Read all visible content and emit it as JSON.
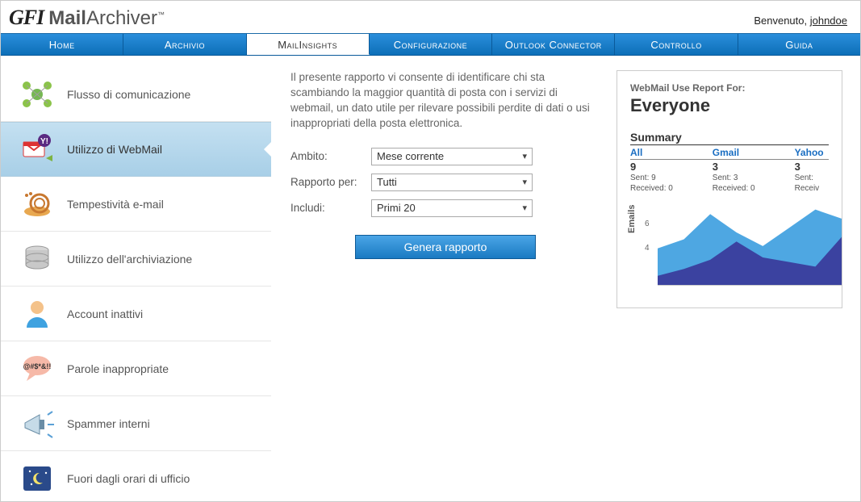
{
  "header": {
    "welcome_prefix": "Benvenuto, ",
    "username": "johndoe"
  },
  "nav": {
    "home": "Home",
    "archive": "Archivio",
    "mailinsights": "MailInsights",
    "config": "Configurazione",
    "outlook": "Outlook Connector",
    "control": "Controllo",
    "guide": "Guida"
  },
  "sidebar": {
    "flow": "Flusso di comunicazione",
    "webmail": "Utilizzo di WebMail",
    "responsiveness": "Tempestività e-mail",
    "storage": "Utilizzo dell'archiviazione",
    "inactive": "Account inattivi",
    "inappropriate": "Parole inappropriate",
    "spammers": "Spammer interni",
    "afterhours": "Fuori dagli orari di ufficio"
  },
  "main": {
    "description": "Il presente rapporto vi consente di identificare chi sta scambiando la maggior quantità di posta con i servizi di webmail, un dato utile per rilevare possibili perdite di dati o usi inappropriati della posta elettronica.",
    "scope_label": "Ambito:",
    "scope_value": "Mese corrente",
    "reportfor_label": "Rapporto per:",
    "reportfor_value": "Tutti",
    "include_label": "Includi:",
    "include_value": "Primi 20",
    "generate_btn": "Genera rapporto"
  },
  "preview": {
    "subtitle": "WebMail Use Report For:",
    "title": "Everyone",
    "summary_header": "Summary",
    "cols": [
      {
        "name": "All",
        "total": "9",
        "sent": "Sent: 9",
        "recv": "Received: 0"
      },
      {
        "name": "Gmail",
        "total": "3",
        "sent": "Sent: 3",
        "recv": "Received: 0"
      },
      {
        "name": "Yahoo",
        "total": "3",
        "sent": "Sent:",
        "recv": "Receiv"
      }
    ],
    "ylabel": "Emails",
    "ticks": {
      "t6": "6",
      "t4": "4"
    }
  },
  "chart_data": {
    "type": "area",
    "ylabel": "Emails",
    "ylim": [
      0,
      7
    ],
    "series": [
      {
        "name": "light",
        "color": "#3f9fe0",
        "values": [
          3.2,
          4.0,
          6.2,
          4.6,
          3.4,
          5.0,
          6.6,
          5.8
        ]
      },
      {
        "name": "dark",
        "color": "#3a3a9a",
        "values": [
          0.8,
          1.4,
          2.2,
          3.8,
          2.4,
          2.0,
          1.6,
          4.2
        ]
      }
    ]
  }
}
